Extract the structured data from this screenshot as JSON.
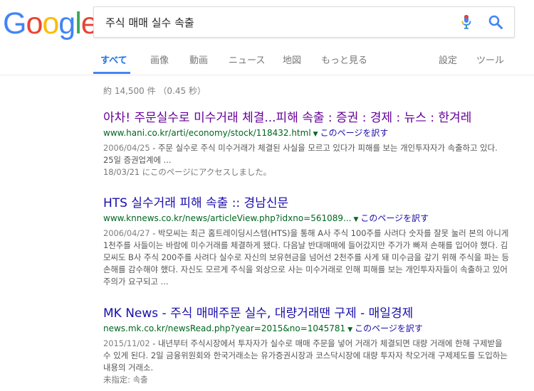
{
  "logo": {
    "letters": [
      {
        "char": "G",
        "color": "#4285f4"
      },
      {
        "char": "o",
        "color": "#ea4335"
      },
      {
        "char": "o",
        "color": "#fbbc05"
      },
      {
        "char": "g",
        "color": "#4285f4"
      },
      {
        "char": "l",
        "color": "#34a853"
      },
      {
        "char": "e",
        "color": "#ea4335"
      }
    ]
  },
  "search": {
    "query": "주식 매매 실수 속출"
  },
  "icons": {
    "mic": "microphone-icon",
    "search": "search-icon"
  },
  "tabs": [
    {
      "label": "すべて",
      "active": true
    },
    {
      "label": "画像"
    },
    {
      "label": "動画"
    },
    {
      "label": "ニュース"
    },
    {
      "label": "地図"
    },
    {
      "label": "もっと見る"
    },
    {
      "label": "設定"
    },
    {
      "label": "ツール"
    }
  ],
  "stats": "約 14,500 件 （0.45 秒）",
  "results": [
    {
      "title": "아차! 주문실수로 미수거래 체결...피해 속출 : 증권 : 경제 : 뉴스 : 한겨레",
      "url": "www.hani.co.kr/arti/economy/stock/118432.html",
      "translate": "このページを訳す",
      "date": "2006/04/25",
      "snippet": " - 주문 실수로 주식 미수거래가 체결된 사실을 모르고 있다가 피해를 보는 개인투자자가 속출하고 있다. 25일 증권업계에 ...",
      "meta": "18/03/21 にこのページにアクセスしました。"
    },
    {
      "title": "HTS 실수거래 피해 속출 :: 경남신문",
      "url": "www.knnews.co.kr/news/articleView.php?idxno=561089...",
      "translate": "このページを訳す",
      "date": "2006/04/27",
      "snippet": " - 박모씨는 최근 홈트레이딩시스템(HTS)을 통해 A사 주식 100주를 사려다 숫자를 잘못 눌러 본의 아니게 1천주를 사들이는 바람에 미수거래를 체결하게 됐다. 다음날 반대매매에 들어갔지만 주가가 빠져 손해를 입어야 했다. 김모씨도 B사 주식 200주를 사려다 실수로 자신의 보유현금을 넘어선 2천주를 사게 돼 미수금을 갚기 위해 주식을 파는 등 손해를 감수해야 했다. 자신도 모르게 주식을 외상으로 사는 미수거래로 인해 피해를 보는 개인투자자들이 속출하고 있어 주의가 요구되고 ..."
    },
    {
      "title": "MK News - 주식 매매주문 실수, 대량거래땐 구제 - 매일경제",
      "url": "news.mk.co.kr/newsRead.php?year=2015&no=1045781",
      "translate": "このページを訳す",
      "date": "2015/11/02",
      "snippet": " - 내년부터 주식시장에서 투자자가 실수로 매매 주문을 넣어 거래가 체결되면 대량 거래에 한해 구제받을 수 있게 된다. 2일 금융위원회와 한국거래소는 유가증권시장과 코스닥시장에 대량 투자자 착오거래 구제제도를 도입하는 내용의 거래소.",
      "meta": "未指定: 속출"
    }
  ]
}
